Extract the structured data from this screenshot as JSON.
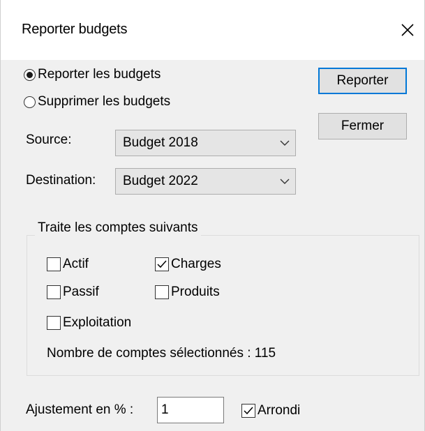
{
  "window": {
    "title": "Reporter budgets"
  },
  "mode": {
    "options": [
      {
        "label": "Reporter les budgets",
        "selected": true
      },
      {
        "label": "Supprimer les budgets",
        "selected": false
      }
    ]
  },
  "source": {
    "label": "Source:",
    "value": "Budget  2018"
  },
  "destination": {
    "label": "Destination:",
    "value": "Budget  2022"
  },
  "buttons": {
    "report": "Reporter",
    "close": "Fermer"
  },
  "accounts": {
    "legend": "Traite les comptes suivants",
    "items": [
      {
        "label": "Actif",
        "checked": false
      },
      {
        "label": "Charges",
        "checked": true
      },
      {
        "label": "Passif",
        "checked": false
      },
      {
        "label": "Produits",
        "checked": false
      },
      {
        "label": "Exploitation",
        "checked": false
      }
    ],
    "count_text": "Nombre de comptes sélectionnés : 115"
  },
  "adjustment": {
    "label": "Ajustement en % :",
    "value": "1"
  },
  "round": {
    "label": "Arrondi",
    "checked": true
  },
  "icons": {
    "close": "close-icon",
    "dropdown": "chevron-down-icon",
    "checkmark": "checkmark-icon"
  },
  "colors": {
    "accent": "#0078d7",
    "dialog_bg": "#f0f0f0"
  }
}
